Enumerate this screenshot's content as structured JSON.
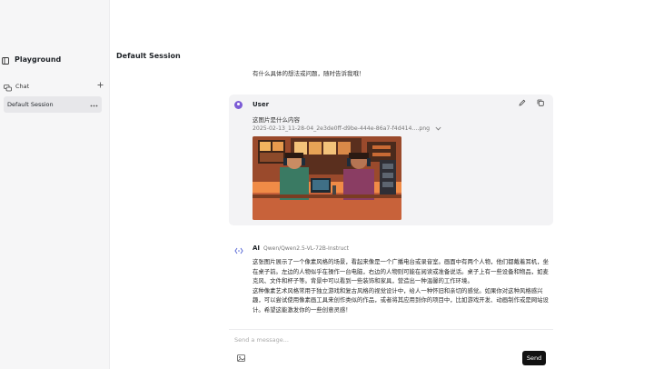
{
  "sidebar": {
    "title": "Playground",
    "chat_label": "Chat",
    "sessions": [
      {
        "label": "Default Session"
      }
    ]
  },
  "main": {
    "session_title": "Default Session",
    "previous_message": "有什么具体的想法或问题，随时告诉我哦！",
    "user_message": {
      "role": "User",
      "text": "这图片是什么内容",
      "attachment_name": "2025-02-13_11-28-04_2e3de0ff-d9be-444e-86a7-f4d414....png"
    },
    "ai_message": {
      "role": "AI",
      "model": "Qwen/Qwen2.5-VL-72B-Instruct",
      "paragraph_1": "这张图片展示了一个像素风格的场景，看起来像是一个广播电台或录音室。画面中有两个人物，他们都戴着耳机，坐在桌子前。左边的人物似乎在操作一台电脑，右边的人物则可能在阅读或准备说话。桌子上有一些设备和物品，如麦克风、文件和杯子等。背景中可以看到一些装饰和家具，营造出一种温馨的工作环境。",
      "paragraph_2": "这种像素艺术风格常用于独立游戏和复古风格的视觉设计中，给人一种怀旧和亲切的感觉。如果你对这种风格感兴趣，可以尝试使用像素画工具来创作类似的作品，或者将其应用到你的项目中，比如游戏开发、动画制作或是网站设计。希望这能激发你的一些创意灵感！"
    }
  },
  "composer": {
    "placeholder": "Send a message...",
    "send_label": "Send"
  },
  "colors": {
    "sidebar_bg": "#f6f6f7",
    "active_item_bg": "#e7e7ea",
    "user_card_bg": "#f3f3f5",
    "user_avatar": "#7c5cd6",
    "send_button": "#111111"
  },
  "icons": [
    "sidebar-panel-icon",
    "chat-bubbles-icon",
    "plus-icon",
    "more-dots-icon",
    "edit-pencil-icon",
    "copy-icon",
    "user-avatar-icon",
    "chevron-down-icon",
    "ai-bot-icon",
    "image-upload-icon"
  ]
}
